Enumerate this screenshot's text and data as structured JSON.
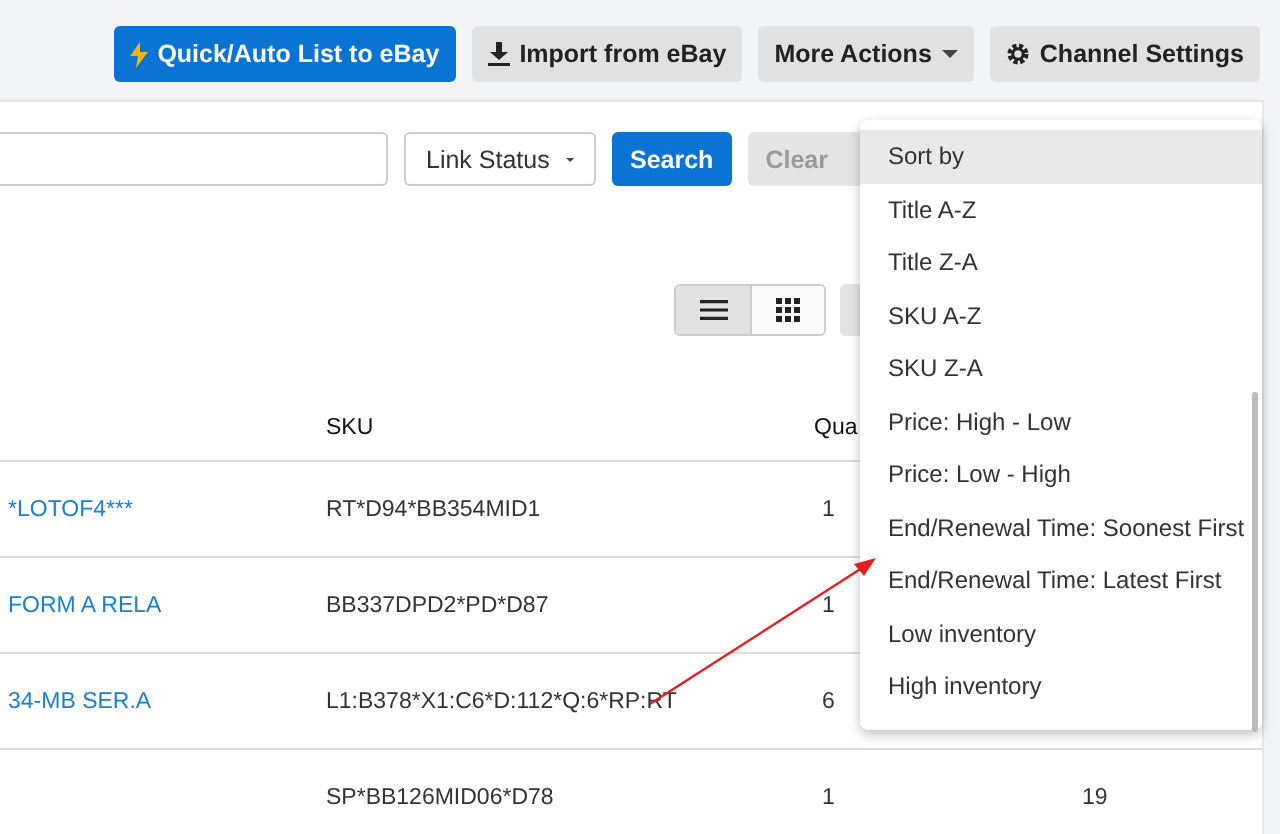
{
  "toolbar": {
    "buttons": [
      {
        "label": "Quick/Auto List to eBay",
        "kind": "primary"
      },
      {
        "label": "Import from eBay",
        "kind": "import"
      },
      {
        "label": "More Actions",
        "kind": "dropdown"
      },
      {
        "label": "Channel Settings",
        "kind": "settings"
      }
    ]
  },
  "filters": {
    "link_status": "Link Status",
    "search": "Search",
    "clear": "Clear"
  },
  "view_toggle": [
    {
      "kind": "list",
      "selected": true
    },
    {
      "kind": "grid",
      "selected": false
    }
  ],
  "table": {
    "columns": [
      "SKU",
      "Qua"
    ],
    "rows": [
      {
        "title": "*LOTOF4***",
        "sku": "RT*D94*BB354MID1",
        "qty": "1"
      },
      {
        "title": "FORM A RELA",
        "sku": "BB337DPD2*PD*D87",
        "qty": "1"
      },
      {
        "title": "34-MB SER.A",
        "sku": "L1:B378*X1:C6*D:112*Q:6*RP:RT",
        "qty": "6"
      },
      {
        "sku": "SP*BB126MID06*D78",
        "qty": "1",
        "column_4": "19"
      }
    ]
  },
  "sort_menu": [
    {
      "label": "Sort by",
      "selected": true
    },
    {
      "label": "Title A-Z",
      "selected": false
    },
    {
      "label": "Title Z-A",
      "selected": false
    },
    {
      "label": "SKU A-Z",
      "selected": false
    },
    {
      "label": "SKU Z-A",
      "selected": false
    },
    {
      "label": "Price: High - Low",
      "selected": false
    },
    {
      "label": "Price: Low - High",
      "selected": false
    },
    {
      "label": "End/Renewal Time: Soonest First",
      "selected": false
    },
    {
      "label": "End/Renewal Time: Latest First",
      "selected": false
    },
    {
      "label": "Low inventory",
      "selected": false
    },
    {
      "label": "High inventory",
      "selected": false
    }
  ]
}
